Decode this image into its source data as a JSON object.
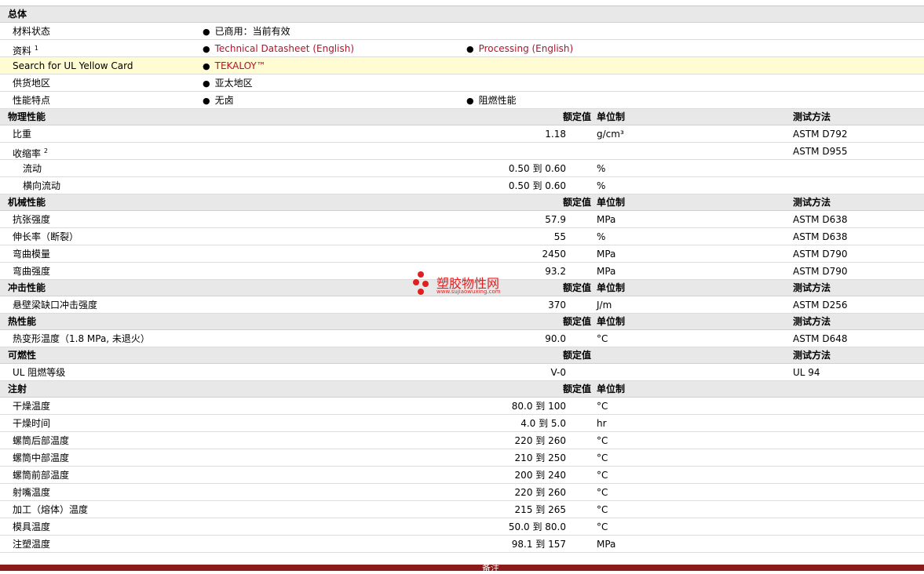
{
  "general": {
    "title": "总体",
    "rows": [
      {
        "label": "材料状态",
        "c1": "已商用：当前有效"
      },
      {
        "label": "资料",
        "sup": "1",
        "c1": "Technical Datasheet (English)",
        "c2": "Processing (English)"
      },
      {
        "label": "Search for UL Yellow Card",
        "c1": "TEKALOY™"
      },
      {
        "label": "供货地区",
        "c1": "亚太地区"
      },
      {
        "label": "性能特点",
        "c1": "无卤",
        "c2": "阻燃性能"
      }
    ]
  },
  "col_headers": {
    "value": "额定值",
    "unit": "单位制",
    "method": "测试方法"
  },
  "physical": {
    "title": "物理性能",
    "rows": [
      {
        "label": "比重",
        "value": "1.18",
        "unit": "g/cm³",
        "method": "ASTM D792"
      },
      {
        "label": "收缩率",
        "sup": "2",
        "value": "",
        "unit": "",
        "method": "ASTM D955"
      },
      {
        "label": "流动",
        "value": "0.50 到  0.60",
        "unit": "%",
        "method": ""
      },
      {
        "label": "横向流动",
        "value": "0.50 到  0.60",
        "unit": "%",
        "method": ""
      }
    ]
  },
  "mechanical": {
    "title": "机械性能",
    "rows": [
      {
        "label": "抗张强度",
        "value": "57.9",
        "unit": "MPa",
        "method": "ASTM D638"
      },
      {
        "label": "伸长率（断裂）",
        "value": "55",
        "unit": "%",
        "method": "ASTM D638"
      },
      {
        "label": "弯曲模量",
        "value": "2450",
        "unit": "MPa",
        "method": "ASTM D790"
      },
      {
        "label": "弯曲强度",
        "value": "93.2",
        "unit": "MPa",
        "method": "ASTM D790"
      }
    ]
  },
  "impact": {
    "title": "冲击性能",
    "rows": [
      {
        "label": "悬壁梁缺口冲击强度",
        "value": "370",
        "unit": "J/m",
        "method": "ASTM D256"
      }
    ]
  },
  "thermal": {
    "title": "热性能",
    "rows": [
      {
        "label": "热变形温度（1.8 MPa, 未退火）",
        "value": "90.0",
        "unit": "°C",
        "method": "ASTM D648"
      }
    ]
  },
  "flammability": {
    "title": "可燃性",
    "rows": [
      {
        "label": "UL 阻燃等级",
        "value": "V-0",
        "unit": "",
        "method": "UL 94"
      }
    ]
  },
  "injection": {
    "title": "注射",
    "rows": [
      {
        "label": "干燥温度",
        "value": "80.0 到  100",
        "unit": "°C"
      },
      {
        "label": "干燥时间",
        "value": "4.0 到  5.0",
        "unit": "hr"
      },
      {
        "label": "螺筒后部温度",
        "value": "220 到  260",
        "unit": "°C"
      },
      {
        "label": "螺筒中部温度",
        "value": "210 到  250",
        "unit": "°C"
      },
      {
        "label": "螺筒前部温度",
        "value": "200 到  240",
        "unit": "°C"
      },
      {
        "label": "射嘴温度",
        "value": "220 到  260",
        "unit": "°C"
      },
      {
        "label": "加工（熔体）温度",
        "value": "215 到  265",
        "unit": "°C"
      },
      {
        "label": "模具温度",
        "value": "50.0 到  80.0",
        "unit": "°C"
      },
      {
        "label": "注塑温度",
        "value": "98.1 到  157",
        "unit": "MPa"
      }
    ]
  },
  "watermark": {
    "title": "塑胶物性网",
    "url": "www.sujiaowuxing.com",
    "color": "#e02020"
  },
  "footer": {
    "label": "备注"
  }
}
